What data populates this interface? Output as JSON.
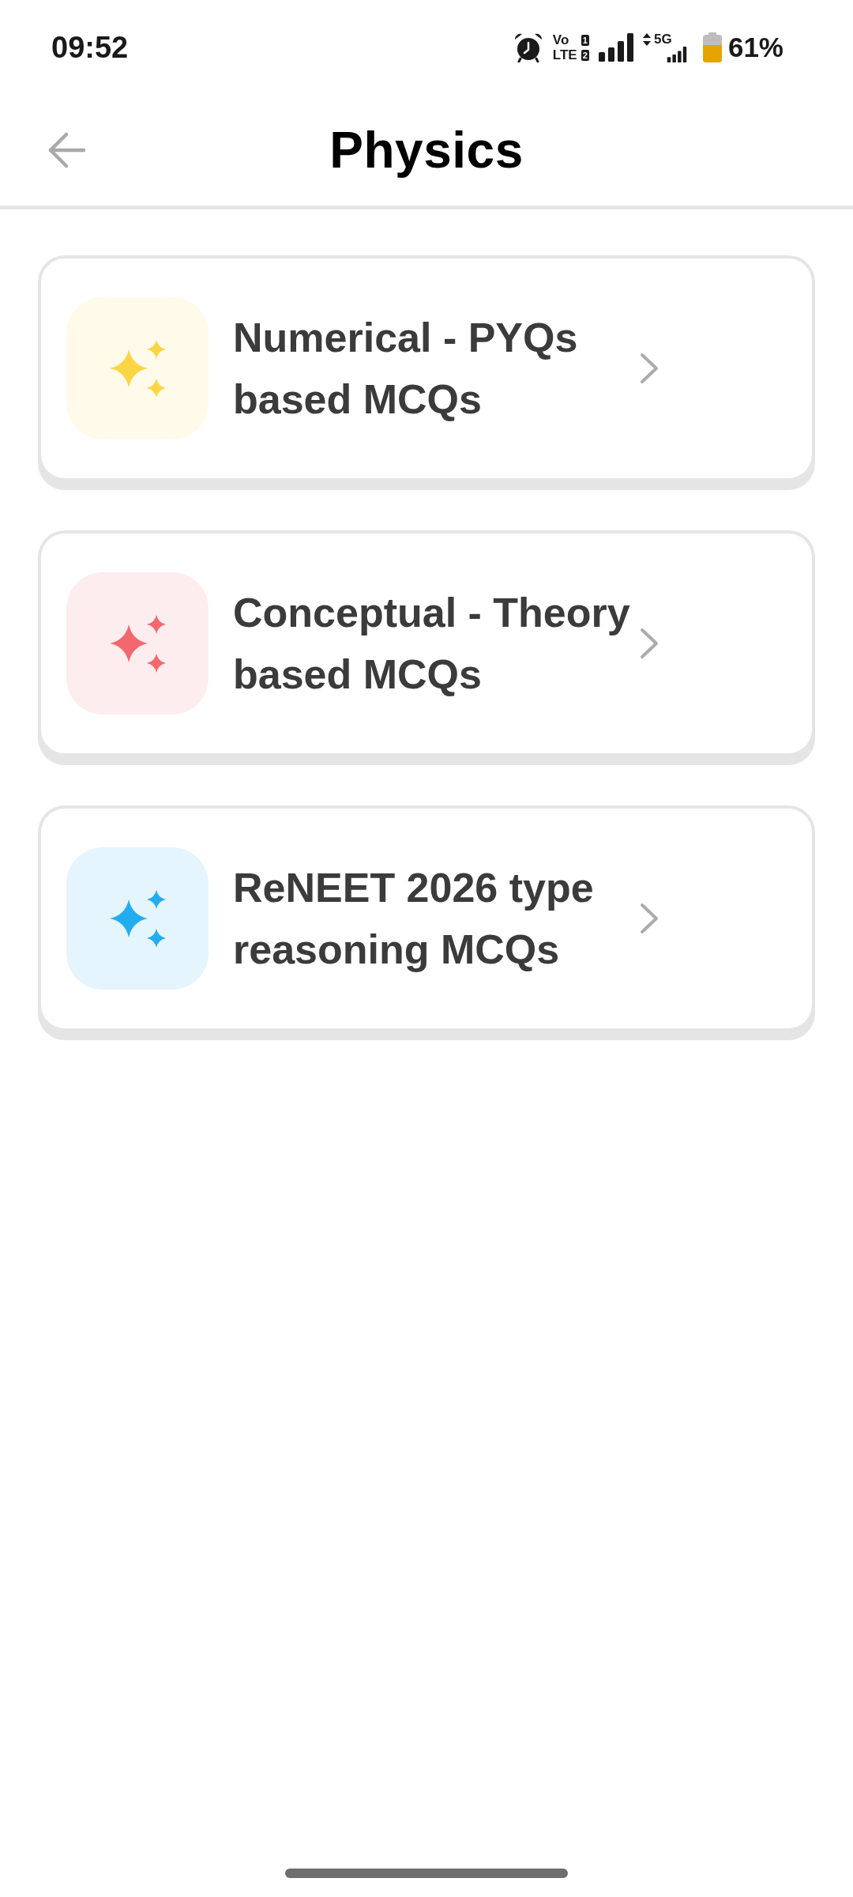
{
  "status_bar": {
    "time": "09:52",
    "network_rows": [
      {
        "label": "Vo",
        "sim": "1"
      },
      {
        "label": "LTE",
        "sim": "2"
      }
    ],
    "network": "5G",
    "battery_percent": "61%"
  },
  "header": {
    "title": "Physics"
  },
  "items": [
    {
      "title": "Numerical - PYQs based MCQs",
      "color": "#fdd544"
    },
    {
      "title": "Conceptual - Theory based MCQs",
      "color": "#f2686e"
    },
    {
      "title": "ReNEET 2026 type reasoning MCQs",
      "color": "#23adf1"
    }
  ]
}
